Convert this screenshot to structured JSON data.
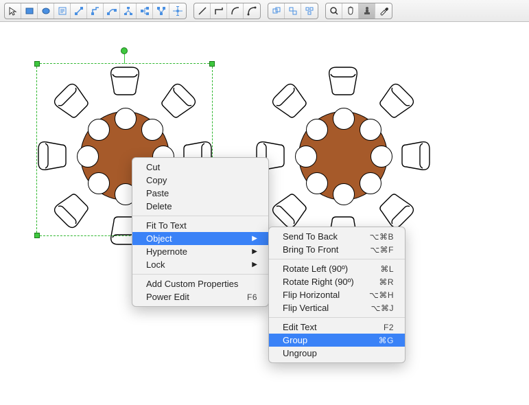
{
  "toolbar": {
    "groups": [
      [
        "pointer",
        "rect",
        "ellipse",
        "text",
        "line-node",
        "poly-node",
        "path-node",
        "tree-node",
        "org-node",
        "branch-node",
        "star-node"
      ],
      [
        "line",
        "elbow",
        "curve",
        "arc"
      ],
      [
        "snap-grid",
        "snap-obj",
        "distribute"
      ],
      [
        "zoom",
        "pan",
        "stamp",
        "eyedrop"
      ]
    ],
    "active": "stamp"
  },
  "context_menu": {
    "items": [
      {
        "label": "Cut"
      },
      {
        "label": "Copy"
      },
      {
        "label": "Paste"
      },
      {
        "label": "Delete"
      },
      {
        "sep": true
      },
      {
        "label": "Fit To Text"
      },
      {
        "label": "Object",
        "submenu": true,
        "hl": true
      },
      {
        "label": "Hypernote",
        "submenu": true
      },
      {
        "label": "Lock",
        "submenu": true
      },
      {
        "sep": true
      },
      {
        "label": "Add Custom Properties"
      },
      {
        "label": "Power Edit",
        "shortcut": "F6"
      }
    ]
  },
  "object_submenu": {
    "items": [
      {
        "label": "Send To Back",
        "shortcut": "⌥⌘B"
      },
      {
        "label": "Bring To Front",
        "shortcut": "⌥⌘F"
      },
      {
        "sep": true
      },
      {
        "label": "Rotate Left (90º)",
        "shortcut": "⌘L"
      },
      {
        "label": "Rotate Right (90º)",
        "shortcut": "⌘R"
      },
      {
        "label": "Flip Horizontal",
        "shortcut": "⌥⌘H"
      },
      {
        "label": "Flip Vertical",
        "shortcut": "⌥⌘J"
      },
      {
        "sep": true
      },
      {
        "label": "Edit Text",
        "shortcut": "F2"
      },
      {
        "label": "Group",
        "shortcut": "⌘G",
        "hl": true
      },
      {
        "label": "Ungroup"
      }
    ]
  }
}
